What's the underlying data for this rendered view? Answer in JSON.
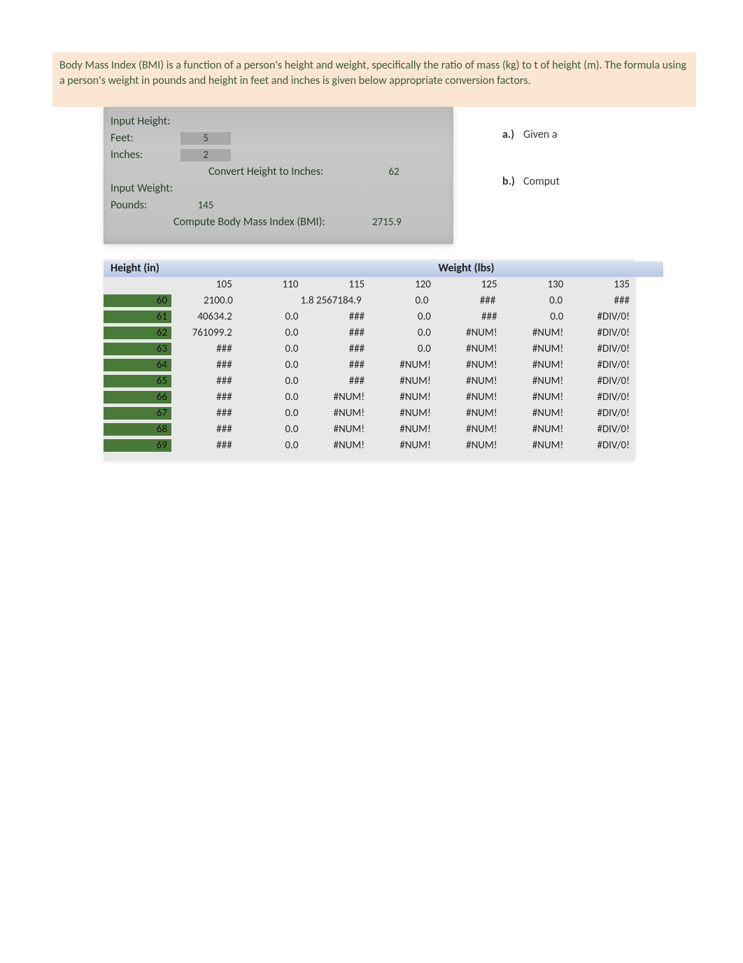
{
  "intro": "Body Mass Index (BMI) is a function of a person's height and weight, specifically the ratio of mass (kg) to t of height (m).   The formula using a person's weight in pounds and height in feet and inches is given below appropriate conversion factors.",
  "inputs": {
    "heightLabel": "Input Height:",
    "feetLabel": "Feet:",
    "feetValue": "5",
    "inchesLabel": "Inches:",
    "inchesValue": "2",
    "convertHeightLabel": "Convert Height to Inches:",
    "convertHeightValue": "62",
    "weightLabel": "Input Weight:",
    "poundsLabel": "Pounds:",
    "poundsValue": "145",
    "bmiLabel": "Compute Body Mass Index (BMI):",
    "bmiValue": "2715.9"
  },
  "side": {
    "aLabel": "a.)",
    "aText": "Given a",
    "bLabel": "b.)",
    "bText": "Comput"
  },
  "table": {
    "heightHeader": "Height (in)",
    "weightHeader": "Weight (lbs)",
    "cols": [
      "105",
      "110",
      "115",
      "120",
      "125",
      "130",
      "135"
    ],
    "rows": [
      {
        "h": "60",
        "cells": [
          "2100.0",
          "1.8",
          "2567184.9",
          "0.0",
          "###",
          "0.0",
          "###"
        ],
        "combine110_115": true
      },
      {
        "h": "61",
        "cells": [
          "40634.2",
          "0.0",
          "###",
          "0.0",
          "###",
          "0.0",
          "#DIV/0!"
        ]
      },
      {
        "h": "62",
        "cells": [
          "761099.2",
          "0.0",
          "###",
          "0.0",
          "#NUM!",
          "#NUM!",
          "#DIV/0!"
        ]
      },
      {
        "h": "63",
        "cells": [
          "###",
          "0.0",
          "###",
          "0.0",
          "#NUM!",
          "#NUM!",
          "#DIV/0!"
        ]
      },
      {
        "h": "64",
        "cells": [
          "###",
          "0.0",
          "###",
          "#NUM!",
          "#NUM!",
          "#NUM!",
          "#DIV/0!"
        ]
      },
      {
        "h": "65",
        "cells": [
          "###",
          "0.0",
          "###",
          "#NUM!",
          "#NUM!",
          "#NUM!",
          "#DIV/0!"
        ]
      },
      {
        "h": "66",
        "cells": [
          "###",
          "0.0",
          "#NUM!",
          "#NUM!",
          "#NUM!",
          "#NUM!",
          "#DIV/0!"
        ]
      },
      {
        "h": "67",
        "cells": [
          "###",
          "0.0",
          "#NUM!",
          "#NUM!",
          "#NUM!",
          "#NUM!",
          "#DIV/0!"
        ]
      },
      {
        "h": "68",
        "cells": [
          "###",
          "0.0",
          "#NUM!",
          "#NUM!",
          "#NUM!",
          "#NUM!",
          "#DIV/0!"
        ]
      },
      {
        "h": "69",
        "cells": [
          "###",
          "0.0",
          "#NUM!",
          "#NUM!",
          "#NUM!",
          "#NUM!",
          "#DIV/0!"
        ]
      }
    ]
  }
}
